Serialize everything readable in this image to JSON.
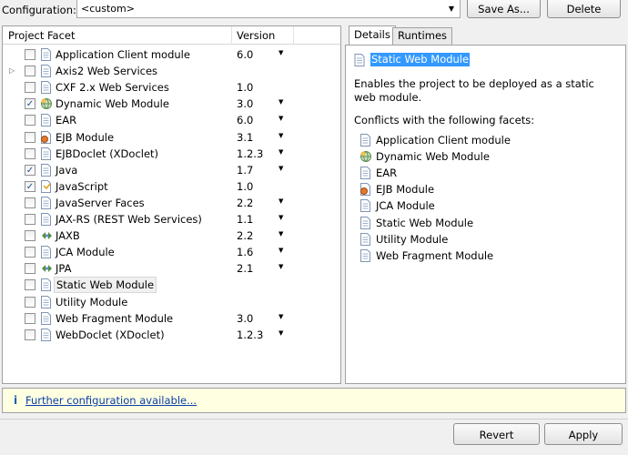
{
  "config": {
    "label": "Configuration:",
    "value": "<custom>",
    "save_as": "Save As...",
    "delete": "Delete"
  },
  "table": {
    "col_facet": "Project Facet",
    "col_version": "Version",
    "rows": [
      {
        "name": "Application Client module",
        "version": "6.0",
        "checked": false,
        "has_dropdown": true,
        "icon": "page-icon",
        "expandable": false
      },
      {
        "name": "Axis2 Web Services",
        "version": "",
        "checked": false,
        "has_dropdown": false,
        "icon": "page-icon",
        "expandable": true
      },
      {
        "name": "CXF 2.x Web Services",
        "version": "1.0",
        "checked": false,
        "has_dropdown": false,
        "icon": "page-icon",
        "expandable": false
      },
      {
        "name": "Dynamic Web Module",
        "version": "3.0",
        "checked": true,
        "has_dropdown": true,
        "icon": "globe-icon",
        "expandable": false
      },
      {
        "name": "EAR",
        "version": "6.0",
        "checked": false,
        "has_dropdown": true,
        "icon": "page-icon",
        "expandable": false
      },
      {
        "name": "EJB Module",
        "version": "3.1",
        "checked": false,
        "has_dropdown": true,
        "icon": "bean-icon",
        "expandable": false
      },
      {
        "name": "EJBDoclet (XDoclet)",
        "version": "1.2.3",
        "checked": false,
        "has_dropdown": true,
        "icon": "page-icon",
        "expandable": false
      },
      {
        "name": "Java",
        "version": "1.7",
        "checked": true,
        "has_dropdown": true,
        "icon": "page-icon",
        "expandable": false
      },
      {
        "name": "JavaScript",
        "version": "1.0",
        "checked": true,
        "has_dropdown": false,
        "icon": "js-icon",
        "expandable": false
      },
      {
        "name": "JavaServer Faces",
        "version": "2.2",
        "checked": false,
        "has_dropdown": true,
        "icon": "page-icon",
        "expandable": false
      },
      {
        "name": "JAX-RS (REST Web Services)",
        "version": "1.1",
        "checked": false,
        "has_dropdown": true,
        "icon": "page-icon",
        "expandable": false
      },
      {
        "name": "JAXB",
        "version": "2.2",
        "checked": false,
        "has_dropdown": true,
        "icon": "arrows-icon",
        "expandable": false
      },
      {
        "name": "JCA Module",
        "version": "1.6",
        "checked": false,
        "has_dropdown": true,
        "icon": "page-icon",
        "expandable": false
      },
      {
        "name": "JPA",
        "version": "2.1",
        "checked": false,
        "has_dropdown": true,
        "icon": "arrows-icon",
        "expandable": false
      },
      {
        "name": "Static Web Module",
        "version": "",
        "checked": false,
        "has_dropdown": false,
        "icon": "page-icon",
        "expandable": false,
        "selected": true
      },
      {
        "name": "Utility Module",
        "version": "",
        "checked": false,
        "has_dropdown": false,
        "icon": "page-icon",
        "expandable": false
      },
      {
        "name": "Web Fragment Module",
        "version": "3.0",
        "checked": false,
        "has_dropdown": true,
        "icon": "page-icon",
        "expandable": false
      },
      {
        "name": "WebDoclet (XDoclet)",
        "version": "1.2.3",
        "checked": false,
        "has_dropdown": true,
        "icon": "page-icon",
        "expandable": false
      }
    ]
  },
  "tabs": {
    "details": "Details",
    "runtimes": "Runtimes"
  },
  "details": {
    "title": "Static Web Module",
    "description": "Enables the project to be deployed as a static web module.",
    "conflicts_label": "Conflicts with the following facets:",
    "conflicts": [
      {
        "name": "Application Client module",
        "icon": "page-icon"
      },
      {
        "name": "Dynamic Web Module",
        "icon": "globe-icon"
      },
      {
        "name": "EAR",
        "icon": "page-icon"
      },
      {
        "name": "EJB Module",
        "icon": "bean-icon"
      },
      {
        "name": "JCA Module",
        "icon": "page-icon"
      },
      {
        "name": "Static Web Module",
        "icon": "page-icon"
      },
      {
        "name": "Utility Module",
        "icon": "page-icon"
      },
      {
        "name": "Web Fragment Module",
        "icon": "page-icon"
      }
    ]
  },
  "info": {
    "link": "Further configuration available..."
  },
  "buttons": {
    "revert": "Revert",
    "apply": "Apply"
  }
}
